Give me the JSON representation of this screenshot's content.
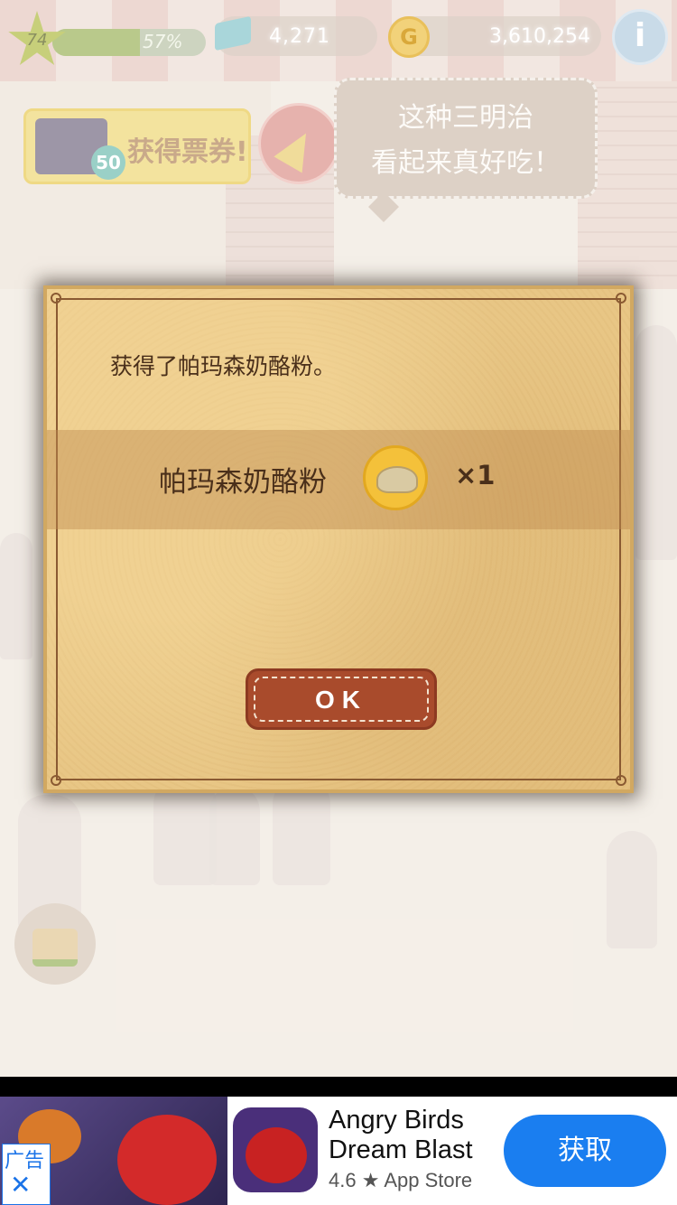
{
  "hud": {
    "level": "74",
    "xp_percent": "57%",
    "xp_fraction": 0.57,
    "tickets": "4,271",
    "coins": "3,610,254",
    "info_label": "i",
    "coin_symbol": "G"
  },
  "ticket_button": {
    "label": "获得票券!",
    "badge": "50"
  },
  "speech_bubble": {
    "line1": "这种三明治",
    "line2": "看起来真好吃！"
  },
  "dialog": {
    "message": "获得了帕玛森奶酪粉。",
    "item_name": "帕玛森奶酪粉",
    "item_icon": "parmesan-cheese-powder-icon",
    "item_quantity": "×1",
    "ok_label": "OK"
  },
  "ad": {
    "badge_text": "广告",
    "close_symbol": "✕",
    "app_name": "Angry Birds Dream Blast",
    "rating": "4.6 ★ App Store",
    "cta": "获取"
  },
  "colors": {
    "dialog_bg": "#e8c685",
    "ok_button": "#a94b2c",
    "ad_cta": "#1a7ef0"
  }
}
